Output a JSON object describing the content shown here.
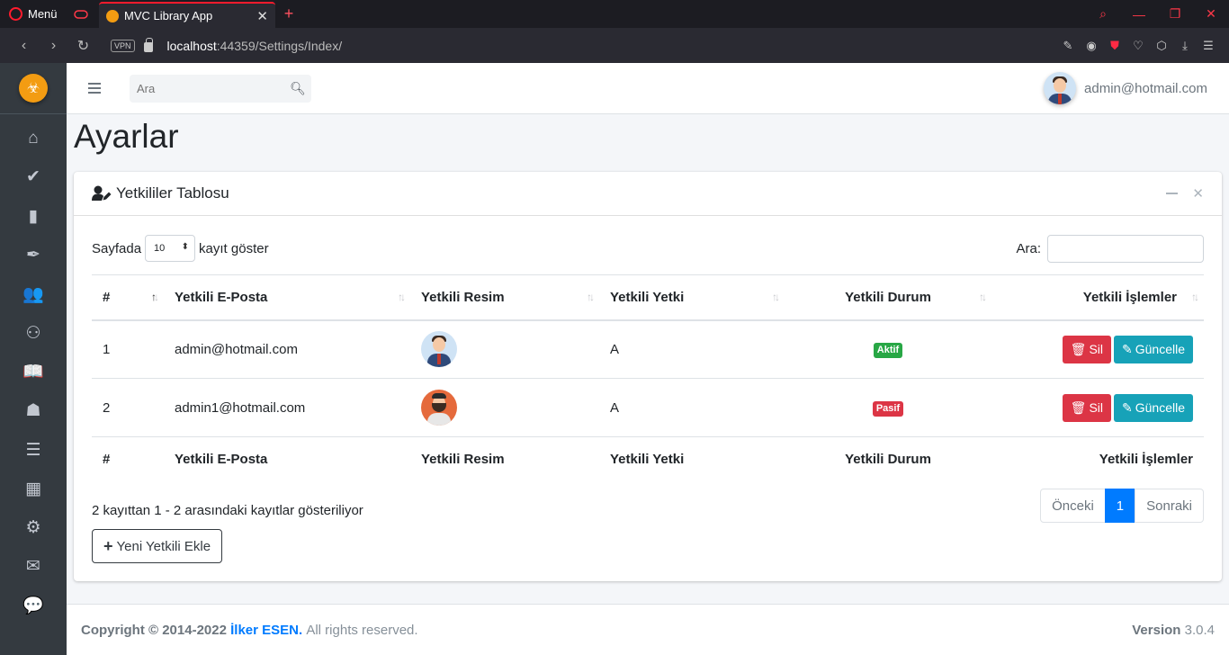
{
  "browser": {
    "menu_label": "Menü",
    "tab_title": "MVC Library App",
    "url_host": "localhost",
    "url_rest": ":44359/Settings/Index/",
    "vpn_label": "VPN"
  },
  "header": {
    "search_placeholder": "Ara",
    "user_email": "admin@hotmail.com"
  },
  "sidebar": {
    "items": [
      "home-icon",
      "double-check-icon",
      "book-icon",
      "feather-pen-icon",
      "users-icon",
      "people-carry-icon",
      "book-open-icon",
      "book-reader-icon",
      "list-icon",
      "building-icon",
      "cogs-icon",
      "envelope-icon",
      "comment-icon"
    ]
  },
  "page": {
    "title": "Ayarlar"
  },
  "card": {
    "title": "Yetkililer Tablosu"
  },
  "datatable": {
    "length_prefix": "Sayfada",
    "length_value": "10",
    "length_suffix": "kayıt göster",
    "search_label": "Ara:",
    "columns": [
      "#",
      "Yetkili E-Posta",
      "Yetkili Resim",
      "Yetkili Yetki",
      "Yetkili Durum",
      "Yetkili İşlemler"
    ],
    "rows": [
      {
        "no": "1",
        "email": "admin@hotmail.com",
        "role": "A",
        "status": "Aktif",
        "status_color": "#28a745"
      },
      {
        "no": "2",
        "email": "admin1@hotmail.com",
        "role": "A",
        "status": "Pasif",
        "status_color": "#dc3545"
      }
    ],
    "delete_label": "Sil",
    "update_label": "Güncelle",
    "info": "2 kayıttan 1 - 2 arasındaki kayıtlar gösteriliyor",
    "pagination": {
      "prev": "Önceki",
      "current": "1",
      "next": "Sonraki"
    },
    "add_button": "Yeni Yetkili Ekle"
  },
  "footer": {
    "copyright_prefix": "Copyright © 2014-2022",
    "author": "İlker ESEN.",
    "rights": "All rights reserved.",
    "version_label": "Version",
    "version_value": "3.0.4"
  }
}
